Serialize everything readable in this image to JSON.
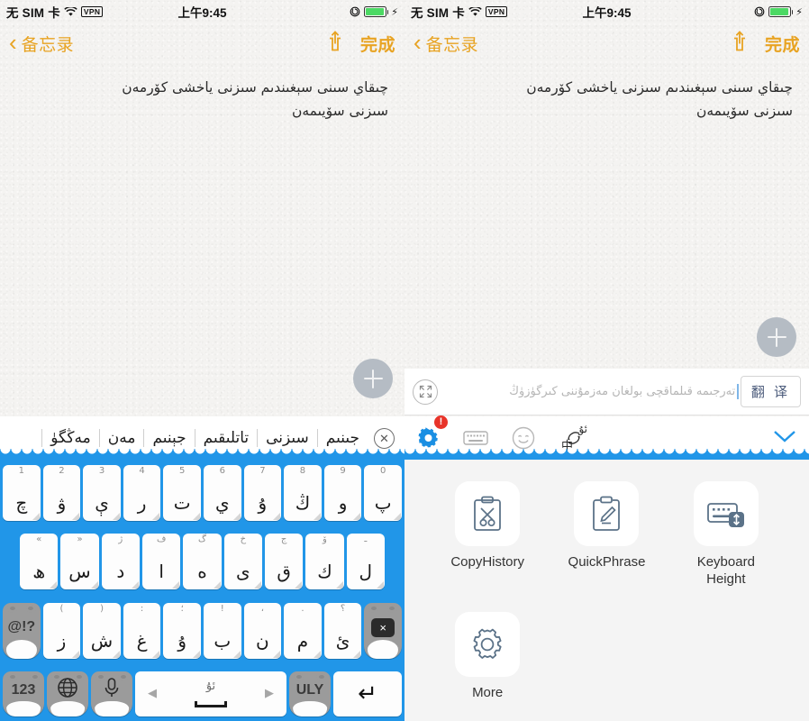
{
  "status_bar": {
    "carrier": "无 SIM 卡",
    "vpn": "VPN",
    "time": "上午9:45",
    "battery_pct": 92
  },
  "nav_bar": {
    "back_label": "备忘录",
    "done_label": "完成"
  },
  "note": {
    "text": "چىقاي سىنى سېغىندىم سىزنى ياخشى كۆرمەن\nسىزنى سۆيىمەن"
  },
  "translate_bar": {
    "placeholder": "تەرجىمە قىلماقچى بولغان مەزمۇننى كىرگۈزۈڭ",
    "button_label": "翻 译"
  },
  "candidates": {
    "items": [
      "جىنىم",
      "سىزنى",
      "تاتلىقىم",
      "جېنىم",
      "مەن",
      "مەڭگۈ"
    ]
  },
  "kb_toolbar": {
    "badge": "!",
    "lang_top": "ئۇ",
    "lang_bottom": "中"
  },
  "keyboard": {
    "row1": [
      {
        "sup": "1",
        "main": "چ"
      },
      {
        "sup": "2",
        "main": "ۋ"
      },
      {
        "sup": "3",
        "main": "ې"
      },
      {
        "sup": "4",
        "main": "ر"
      },
      {
        "sup": "5",
        "main": "ت"
      },
      {
        "sup": "6",
        "main": "ي"
      },
      {
        "sup": "7",
        "main": "ۇ"
      },
      {
        "sup": "8",
        "main": "ڭ"
      },
      {
        "sup": "9",
        "main": "و"
      },
      {
        "sup": "0",
        "main": "پ"
      }
    ],
    "row2": [
      {
        "sup": "«",
        "main": "ھ"
      },
      {
        "sup": "»",
        "main": "س"
      },
      {
        "sup": "ژ",
        "main": "د"
      },
      {
        "sup": "ف",
        "main": "ا"
      },
      {
        "sup": "گ",
        "main": "ە"
      },
      {
        "sup": "خ",
        "main": "ى"
      },
      {
        "sup": "ج",
        "main": "ق"
      },
      {
        "sup": "ۆ",
        "main": "ك"
      },
      {
        "sup": "ـ",
        "main": "ل"
      }
    ],
    "row3": [
      {
        "sup": "(",
        "main": "ز"
      },
      {
        "sup": ")",
        "main": "ش"
      },
      {
        "sup": ":",
        "main": "غ"
      },
      {
        "sup": "؛",
        "main": "ۇ"
      },
      {
        "sup": "!",
        "main": "ب"
      },
      {
        "sup": "،",
        "main": "ن"
      },
      {
        "sup": ".",
        "main": "م"
      },
      {
        "sup": "؟",
        "main": "ئ"
      }
    ],
    "symbol_key": "@!?",
    "delete_key": "×",
    "num_key": "123",
    "uly_key": "ULY",
    "space_label": "ئۇ",
    "enter_key": "↵"
  },
  "feature_panel": {
    "items": [
      {
        "label": "CopyHistory",
        "icon": "clipboard-scissors-icon"
      },
      {
        "label": "QuickPhrase",
        "icon": "clipboard-pencil-icon"
      },
      {
        "label": "Keyboard Height",
        "icon": "keyboard-height-icon"
      },
      {
        "label": "More",
        "icon": "gear-icon"
      }
    ]
  }
}
